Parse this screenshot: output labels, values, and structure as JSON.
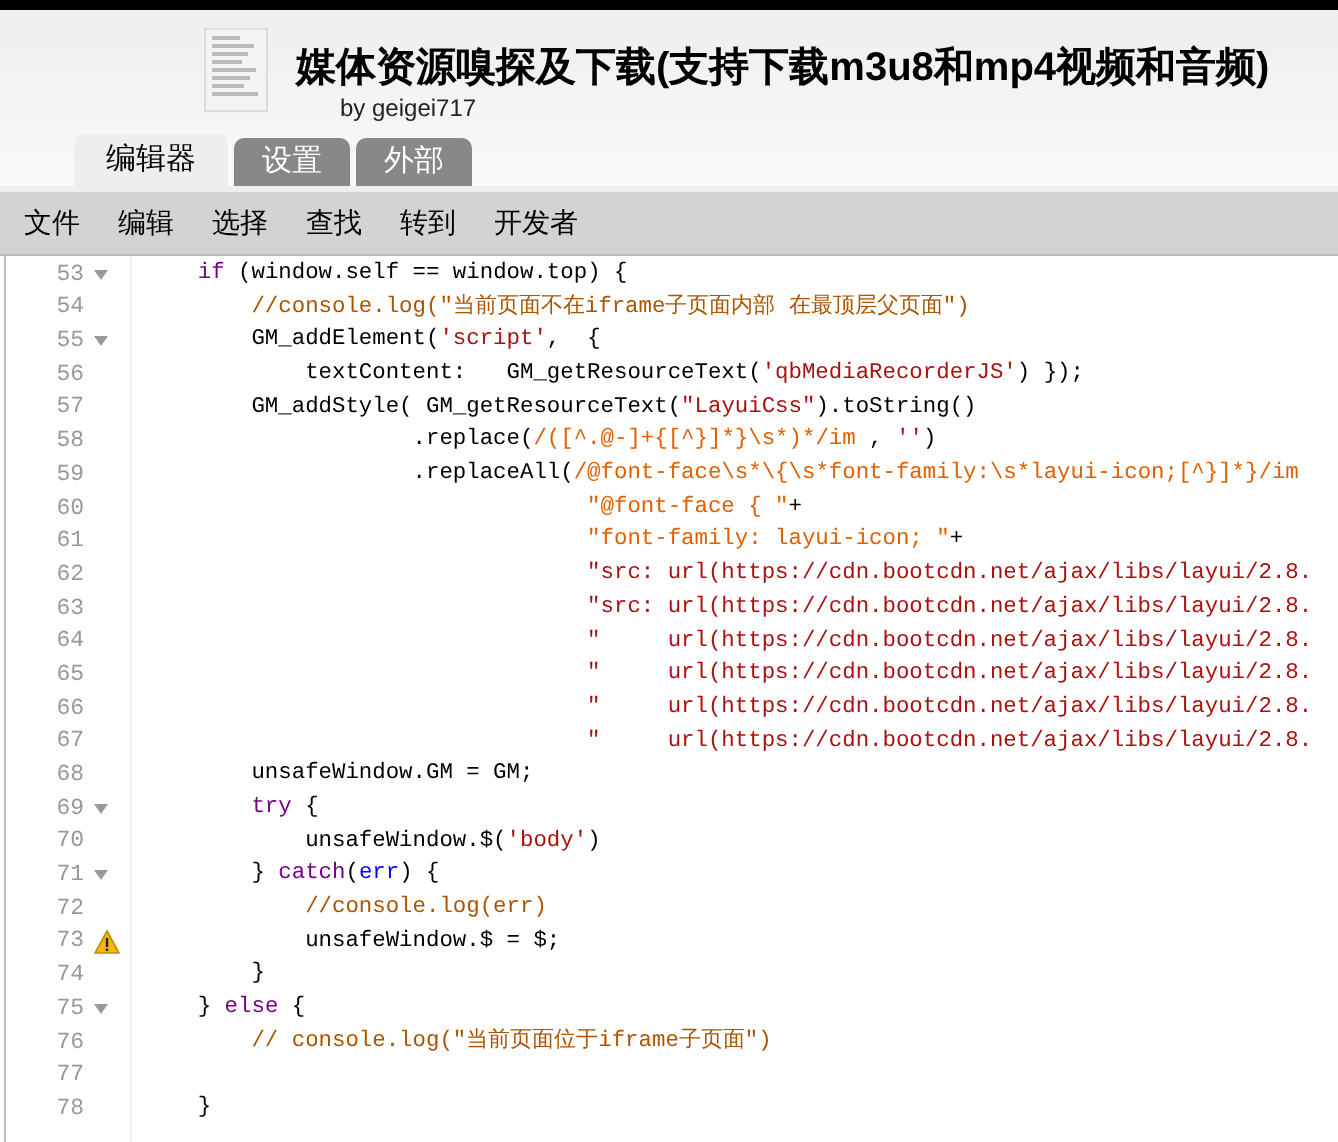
{
  "header": {
    "title": "媒体资源嗅探及下载(支持下载m3u8和mp4视频和音频)",
    "author": "by geigei717"
  },
  "tabs": [
    {
      "label": "编辑器",
      "selected": true
    },
    {
      "label": "设置",
      "selected": false
    },
    {
      "label": "外部",
      "selected": false
    }
  ],
  "menu": [
    "文件",
    "编辑",
    "选择",
    "查找",
    "转到",
    "开发者"
  ],
  "editor": {
    "lines": [
      {
        "number": "53",
        "foldable": true,
        "warning": false,
        "tokens": [
          {
            "kind": "keyword",
            "text": "    if"
          },
          {
            "kind": "plain",
            "text": " (window.self == window.top) {"
          }
        ]
      },
      {
        "number": "54",
        "foldable": false,
        "warning": false,
        "tokens": [
          {
            "kind": "comment",
            "text": "        //console.log(\"当前页面不在iframe子页面内部 在最顶层父页面\")"
          }
        ]
      },
      {
        "number": "55",
        "foldable": true,
        "warning": false,
        "tokens": [
          {
            "kind": "plain",
            "text": "        GM_addElement("
          },
          {
            "kind": "string",
            "text": "'script'"
          },
          {
            "kind": "plain",
            "text": ",  {"
          }
        ]
      },
      {
        "number": "56",
        "foldable": false,
        "warning": false,
        "tokens": [
          {
            "kind": "plain",
            "text": "            textContent:   GM_getResourceText("
          },
          {
            "kind": "string",
            "text": "'qbMediaRecorderJS'"
          },
          {
            "kind": "plain",
            "text": ") });"
          }
        ]
      },
      {
        "number": "57",
        "foldable": false,
        "warning": false,
        "tokens": [
          {
            "kind": "plain",
            "text": "        GM_addStyle( GM_getResourceText("
          },
          {
            "kind": "string",
            "text": "\"LayuiCss\""
          },
          {
            "kind": "plain",
            "text": ").toString()"
          }
        ]
      },
      {
        "number": "58",
        "foldable": false,
        "warning": false,
        "tokens": [
          {
            "kind": "plain",
            "text": "                    .replace("
          },
          {
            "kind": "regex",
            "text": "/([^.@-]+{[^}]*}\\s*)*/im"
          },
          {
            "kind": "plain",
            "text": " , "
          },
          {
            "kind": "string",
            "text": "''"
          },
          {
            "kind": "plain",
            "text": ")"
          }
        ]
      },
      {
        "number": "59",
        "foldable": false,
        "warning": false,
        "tokens": [
          {
            "kind": "plain",
            "text": "                    .replaceAll("
          },
          {
            "kind": "regex",
            "text": "/@font-face\\s*\\{\\s*font-family:\\s*layui-icon;[^}]*}/im"
          }
        ]
      },
      {
        "number": "60",
        "foldable": false,
        "warning": false,
        "tokens": [
          {
            "kind": "regex",
            "text": "                                 \"@font-face { \""
          },
          {
            "kind": "plain",
            "text": "+"
          }
        ]
      },
      {
        "number": "61",
        "foldable": false,
        "warning": false,
        "tokens": [
          {
            "kind": "regex",
            "text": "                                 \"font-family: layui-icon; \""
          },
          {
            "kind": "plain",
            "text": "+"
          }
        ]
      },
      {
        "number": "62",
        "foldable": false,
        "warning": false,
        "tokens": [
          {
            "kind": "string",
            "text": "                                 \"src: url(https://cdn.bootcdn.net/ajax/libs/layui/2.8."
          }
        ]
      },
      {
        "number": "63",
        "foldable": false,
        "warning": false,
        "tokens": [
          {
            "kind": "string",
            "text": "                                 \"src: url(https://cdn.bootcdn.net/ajax/libs/layui/2.8."
          }
        ]
      },
      {
        "number": "64",
        "foldable": false,
        "warning": false,
        "tokens": [
          {
            "kind": "string",
            "text": "                                 \"     url(https://cdn.bootcdn.net/ajax/libs/layui/2.8."
          }
        ]
      },
      {
        "number": "65",
        "foldable": false,
        "warning": false,
        "tokens": [
          {
            "kind": "string",
            "text": "                                 \"     url(https://cdn.bootcdn.net/ajax/libs/layui/2.8."
          }
        ]
      },
      {
        "number": "66",
        "foldable": false,
        "warning": false,
        "tokens": [
          {
            "kind": "string",
            "text": "                                 \"     url(https://cdn.bootcdn.net/ajax/libs/layui/2.8."
          }
        ]
      },
      {
        "number": "67",
        "foldable": false,
        "warning": false,
        "tokens": [
          {
            "kind": "string",
            "text": "                                 \"     url(https://cdn.bootcdn.net/ajax/libs/layui/2.8."
          }
        ]
      },
      {
        "number": "68",
        "foldable": false,
        "warning": false,
        "tokens": [
          {
            "kind": "plain",
            "text": "        unsafeWindow.GM = GM;"
          }
        ]
      },
      {
        "number": "69",
        "foldable": true,
        "warning": false,
        "tokens": [
          {
            "kind": "keyword",
            "text": "        try"
          },
          {
            "kind": "plain",
            "text": " {"
          }
        ]
      },
      {
        "number": "70",
        "foldable": false,
        "warning": false,
        "tokens": [
          {
            "kind": "plain",
            "text": "            unsafeWindow.$("
          },
          {
            "kind": "string",
            "text": "'body'"
          },
          {
            "kind": "plain",
            "text": ")"
          }
        ]
      },
      {
        "number": "71",
        "foldable": true,
        "warning": false,
        "tokens": [
          {
            "kind": "plain",
            "text": "        } "
          },
          {
            "kind": "keyword",
            "text": "catch"
          },
          {
            "kind": "plain",
            "text": "("
          },
          {
            "kind": "def",
            "text": "err"
          },
          {
            "kind": "plain",
            "text": ") {"
          }
        ]
      },
      {
        "number": "72",
        "foldable": false,
        "warning": false,
        "tokens": [
          {
            "kind": "comment",
            "text": "            //console.log(err)"
          }
        ]
      },
      {
        "number": "73",
        "foldable": false,
        "warning": true,
        "tokens": [
          {
            "kind": "plain",
            "text": "            unsafeWindow.$ = $;"
          }
        ]
      },
      {
        "number": "74",
        "foldable": false,
        "warning": false,
        "tokens": [
          {
            "kind": "plain",
            "text": "        }"
          }
        ]
      },
      {
        "number": "75",
        "foldable": true,
        "warning": false,
        "tokens": [
          {
            "kind": "plain",
            "text": "    } "
          },
          {
            "kind": "keyword",
            "text": "else"
          },
          {
            "kind": "plain",
            "text": " {"
          }
        ]
      },
      {
        "number": "76",
        "foldable": false,
        "warning": false,
        "tokens": [
          {
            "kind": "comment",
            "text": "        // console.log(\"当前页面位于iframe子页面\")"
          }
        ]
      },
      {
        "number": "77",
        "foldable": false,
        "warning": false
      },
      {
        "number": "78",
        "foldable": false,
        "warning": false,
        "tokens": [
          {
            "kind": "plain",
            "text": "    }"
          }
        ]
      }
    ]
  }
}
